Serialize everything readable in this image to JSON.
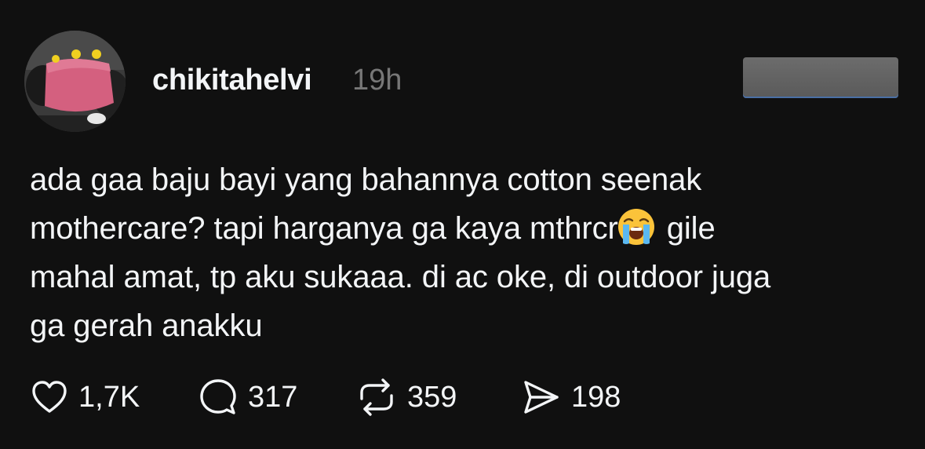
{
  "post": {
    "username": "chikitahelvi",
    "time": "19h",
    "text_lines": [
      "ada gaa baju bayi yang bahannya cotton seenak",
      "mothercare? tapi harganya ga kaya mthrcr",
      "gile",
      "mahal amat, tp aku sukaaa. di ac oke, di outdoor juga",
      "ga gerah anakku"
    ],
    "emoji": "loudly-crying-face-emoji"
  },
  "actions": {
    "likes": "1,7K",
    "replies": "317",
    "reposts": "359",
    "shares": "198"
  },
  "icons": {
    "like": "heart-icon",
    "reply": "speech-bubble-icon",
    "repost": "repost-arrows-icon",
    "share": "paper-plane-icon"
  },
  "colors": {
    "background": "#101010",
    "text": "#f3f5f7",
    "muted": "#777777"
  }
}
